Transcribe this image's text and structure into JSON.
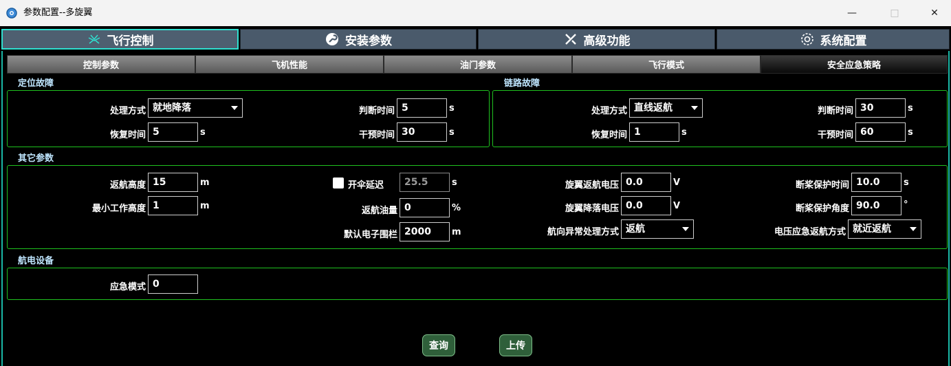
{
  "window": {
    "title": "参数配置--多旋翼",
    "min": "—",
    "max": "□",
    "close": "✕"
  },
  "main_tabs": [
    {
      "label": "飞行控制",
      "icon": "drone-icon",
      "active": true
    },
    {
      "label": "安装参数",
      "icon": "wrench-circle-icon",
      "active": false
    },
    {
      "label": "高级功能",
      "icon": "tools-icon",
      "active": false
    },
    {
      "label": "系统配置",
      "icon": "gear-icon",
      "active": false
    }
  ],
  "sub_tabs": [
    {
      "label": "控制参数",
      "active": false
    },
    {
      "label": "飞机性能",
      "active": false
    },
    {
      "label": "油门参数",
      "active": false
    },
    {
      "label": "飞行模式",
      "active": false
    },
    {
      "label": "安全应急策略",
      "active": true
    }
  ],
  "positioning_fault": {
    "title": "定位故障",
    "handling_label": "处理方式",
    "handling_value": "就地降落",
    "judge_label": "判断时间",
    "judge_value": "5",
    "judge_unit": "s",
    "recover_label": "恢复时间",
    "recover_value": "5",
    "recover_unit": "s",
    "intervene_label": "干预时间",
    "intervene_value": "30",
    "intervene_unit": "s"
  },
  "link_fault": {
    "title": "链路故障",
    "handling_label": "处理方式",
    "handling_value": "直线返航",
    "judge_label": "判断时间",
    "judge_value": "30",
    "judge_unit": "s",
    "recover_label": "恢复时间",
    "recover_value": "1",
    "recover_unit": "s",
    "intervene_label": "干预时间",
    "intervene_value": "60",
    "intervene_unit": "s"
  },
  "other_params": {
    "title": "其它参数",
    "rth_height_label": "返航高度",
    "rth_height_value": "15",
    "rth_height_unit": "m",
    "min_height_label": "最小工作高度",
    "min_height_value": "1",
    "min_height_unit": "m",
    "chute_label": "开伞延迟",
    "chute_value": "25.5",
    "chute_unit": "s",
    "rth_fuel_label": "返航油量",
    "rth_fuel_value": "0",
    "rth_fuel_unit": "%",
    "fence_label": "默认电子围栏",
    "fence_value": "2000",
    "fence_unit": "m",
    "rotor_rth_v_label": "旋翼返航电压",
    "rotor_rth_v_value": "0.0",
    "rotor_rth_v_unit": "V",
    "rotor_land_v_label": "旋翼降落电压",
    "rotor_land_v_value": "0.0",
    "rotor_land_v_unit": "V",
    "heading_label": "航向异常处理方式",
    "heading_value": "返航",
    "prop_time_label": "断桨保护时间",
    "prop_time_value": "10.0",
    "prop_time_unit": "s",
    "prop_angle_label": "断桨保护角度",
    "prop_angle_value": "90.0",
    "prop_angle_unit": "°",
    "voltage_rth_label": "电压应急返航方式",
    "voltage_rth_value": "就近返航"
  },
  "avionics": {
    "title": "航电设备",
    "mode_label": "应急模式",
    "mode_value": "0"
  },
  "buttons": {
    "query": "查询",
    "upload": "上传"
  }
}
